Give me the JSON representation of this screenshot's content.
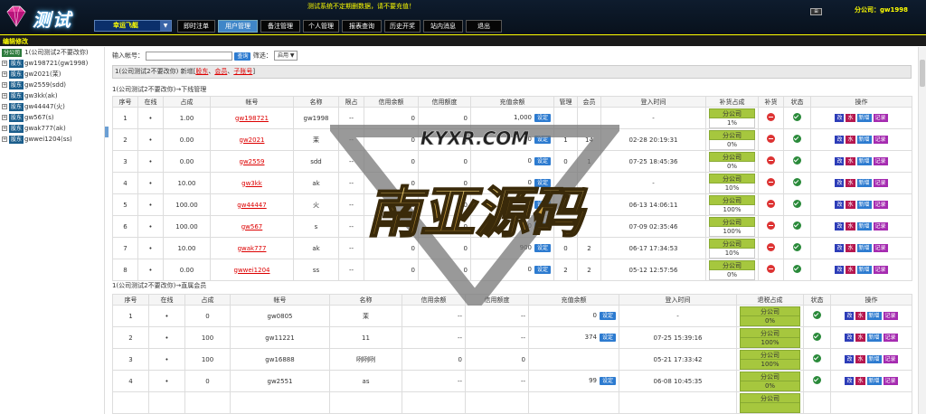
{
  "header": {
    "logo_text": "测试",
    "notice": "测试系统不定期删数据，请不要充值！",
    "balance": "分公司：gw1998",
    "game_selector": "幸运飞艇",
    "corner_label": "⊞"
  },
  "nav": {
    "tabs": [
      {
        "label": "即时注单"
      },
      {
        "label": "用户管理"
      },
      {
        "label": "备注管理"
      },
      {
        "label": "个人管理"
      },
      {
        "label": "报表查询"
      },
      {
        "label": "历史开奖"
      },
      {
        "label": "站内消息"
      },
      {
        "label": "退出"
      }
    ],
    "active_index": 1
  },
  "page_title": "编辑修改",
  "sidebar": {
    "root_badge": "分公司",
    "root_label": "1(公司测试2不要改你)",
    "items": [
      {
        "badge": "股东",
        "label": "gw198721(gw1998)"
      },
      {
        "badge": "股东",
        "label": "gw2021(茉)"
      },
      {
        "badge": "股东",
        "label": "gw2559(sdd)"
      },
      {
        "badge": "股东",
        "label": "gw3kk(ak)"
      },
      {
        "badge": "股东",
        "label": "gw44447(火)"
      },
      {
        "badge": "股东",
        "label": "gw567(s)"
      },
      {
        "badge": "股东",
        "label": "gwak777(ak)"
      },
      {
        "badge": "股东",
        "label": "gwwei1204(ss)"
      }
    ]
  },
  "search": {
    "label": "输入帐号：",
    "value": "",
    "button": "查询",
    "filter_label": "筛选：",
    "filter_value": "启用 ▼"
  },
  "crumb": {
    "prefix": "1(公司测试2不要改你) 新增[",
    "link1": "股东",
    "sep1": "、",
    "link2": "会员",
    "sep2": "、",
    "link3": "子账号",
    "suffix": "]"
  },
  "sub_table": {
    "title": "1(公司测试2不要改你)→下线管理",
    "headers": [
      "序号",
      "在线",
      "占成",
      "帐号",
      "名称",
      "限占",
      "信用余额",
      "信用额度",
      "充值余额",
      "管理",
      "会员",
      "登入时间",
      "补货占成",
      "补货",
      "状态",
      "操作"
    ],
    "rows": [
      {
        "idx": "1",
        "online": "•",
        "share": "1.00",
        "account": "gw198721",
        "name": "gw1998",
        "limit": "--",
        "credit_bal": "0",
        "credit_lim": "0",
        "recharge": "1,000",
        "mgmt": "",
        "members": "",
        "login": "-",
        "fill_label": "分公司",
        "fill_pct": "1%"
      },
      {
        "idx": "2",
        "online": "•",
        "share": "0.00",
        "account": "gw2021",
        "name": "茉",
        "limit": "--",
        "credit_bal": "0",
        "credit_lim": "0",
        "recharge": "0",
        "mgmt": "1",
        "members": "14",
        "login": "02-28 20:19:31",
        "fill_label": "分公司",
        "fill_pct": "0%"
      },
      {
        "idx": "3",
        "online": "•",
        "share": "0.00",
        "account": "gw2559",
        "name": "sdd",
        "limit": "--",
        "credit_bal": "0",
        "credit_lim": "0",
        "recharge": "0",
        "mgmt": "0",
        "members": "1",
        "login": "07-25 18:45:36",
        "fill_label": "分公司",
        "fill_pct": "0%"
      },
      {
        "idx": "4",
        "online": "•",
        "share": "10.00",
        "account": "gw3kk",
        "name": "ak",
        "limit": "--",
        "credit_bal": "0",
        "credit_lim": "0",
        "recharge": "0",
        "mgmt": "",
        "members": "",
        "login": "-",
        "fill_label": "分公司",
        "fill_pct": "10%"
      },
      {
        "idx": "5",
        "online": "•",
        "share": "100.00",
        "account": "gw44447",
        "name": "火",
        "limit": "--",
        "credit_bal": "0",
        "credit_lim": "0",
        "recharge": "0",
        "mgmt": "",
        "members": "",
        "login": "06-13 14:06:11",
        "fill_label": "分公司",
        "fill_pct": "100%"
      },
      {
        "idx": "6",
        "online": "•",
        "share": "100.00",
        "account": "gw567",
        "name": "s",
        "limit": "--",
        "credit_bal": "0",
        "credit_lim": "0",
        "recharge": "0",
        "mgmt": "",
        "members": "",
        "login": "07-09 02:35:46",
        "fill_label": "分公司",
        "fill_pct": "100%"
      },
      {
        "idx": "7",
        "online": "•",
        "share": "10.00",
        "account": "gwak777",
        "name": "ak",
        "limit": "--",
        "credit_bal": "0",
        "credit_lim": "0",
        "recharge": "900",
        "mgmt": "0",
        "members": "2",
        "login": "06-17 17:34:53",
        "fill_label": "分公司",
        "fill_pct": "10%"
      },
      {
        "idx": "8",
        "online": "•",
        "share": "0.00",
        "account": "gwwei1204",
        "name": "ss",
        "limit": "--",
        "credit_bal": "0",
        "credit_lim": "0",
        "recharge": "0",
        "mgmt": "2",
        "members": "2",
        "login": "05-12 12:57:56",
        "fill_label": "分公司",
        "fill_pct": "0%"
      }
    ]
  },
  "member_table": {
    "title": "1(公司测试2不要改你)→直属会员",
    "headers": [
      "序号",
      "在线",
      "占成",
      "帐号",
      "名称",
      "信用余额",
      "信用额度",
      "充值余额",
      "登入时间",
      "退税占成",
      "状态",
      "操作"
    ],
    "rows": [
      {
        "idx": "1",
        "online": "•",
        "share": "0",
        "account": "gw0805",
        "name": "茉",
        "credit_bal": "--",
        "credit_lim": "--",
        "recharge": "0",
        "login": "-",
        "fill_label": "分公司",
        "fill_pct": "0%"
      },
      {
        "idx": "2",
        "online": "•",
        "share": "100",
        "account": "gw11221",
        "name": "11",
        "credit_bal": "--",
        "credit_lim": "--",
        "recharge": "374",
        "login": "07-25 15:39:16",
        "fill_label": "分公司",
        "fill_pct": "100%"
      },
      {
        "idx": "3",
        "online": "•",
        "share": "100",
        "account": "gw16888",
        "name": "咧咧咧",
        "credit_bal": "0",
        "credit_lim": "0",
        "recharge": "",
        "login": "05-21 17:33:42",
        "fill_label": "分公司",
        "fill_pct": "100%"
      },
      {
        "idx": "4",
        "online": "•",
        "share": "0",
        "account": "gw2551",
        "name": "as",
        "credit_bal": "--",
        "credit_lim": "--",
        "recharge": "99",
        "login": "06-08 10:45:35",
        "fill_label": "分公司",
        "fill_pct": "0%"
      },
      {
        "idx": "",
        "online": "",
        "share": "",
        "account": "",
        "name": "",
        "credit_bal": "",
        "credit_lim": "",
        "recharge": "",
        "login": "",
        "fill_label": "分公司",
        "fill_pct": ""
      }
    ]
  },
  "labels": {
    "set_button": "设定",
    "ops": [
      "改",
      "水",
      "新增",
      "记录"
    ]
  },
  "watermark": {
    "line1": "KYXR.COM",
    "line2": "南亚源码"
  },
  "colors": {
    "accent": "#3f86c8",
    "header_bg": "#0e1c2e",
    "link_red": "#dd0000",
    "fill_green": "#a6c73e"
  }
}
